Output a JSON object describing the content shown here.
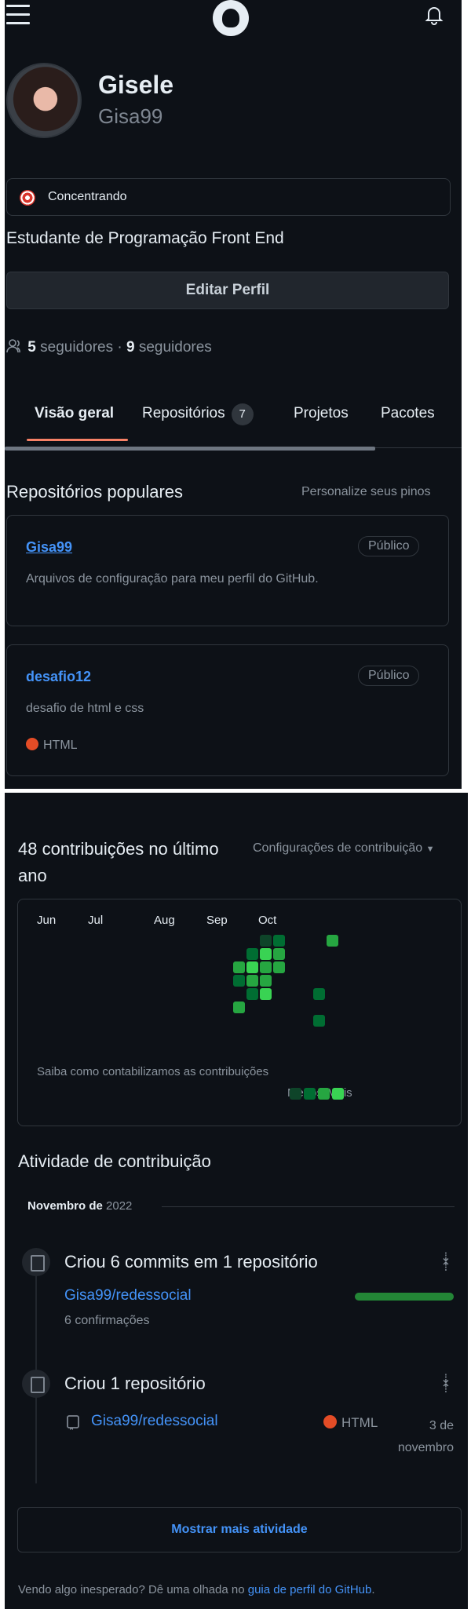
{
  "header": {
    "menu_icon": "hamburger-icon",
    "logo_icon": "github-logo-icon",
    "bell_icon": "bell-icon"
  },
  "profile": {
    "name": "Gisele",
    "login": "Gisa99",
    "status": "Concentrando",
    "status_icon": "dart-target-icon",
    "bio": "Estudante de Programação Front End",
    "edit_button": "Editar Perfil",
    "followers_count": "5",
    "followers_label": "seguidores",
    "following_count": "9",
    "following_label": "seguidores",
    "separator": "·"
  },
  "tabs": [
    {
      "label": "Visão geral",
      "selected": true
    },
    {
      "label": "Repositórios",
      "count": "7"
    },
    {
      "label": "Projetos"
    },
    {
      "label": "Pacotes"
    }
  ],
  "popular": {
    "title": "Repositórios populares",
    "customize": "Personalize seus pinos",
    "repos": [
      {
        "name": "Gisa99",
        "visibility": "Público",
        "description": "Arquivos de configuração para meu perfil do GitHub."
      },
      {
        "name": "desafio12",
        "visibility": "Público",
        "description": "desafio de html e css",
        "language": "HTML",
        "language_color": "#e34c26"
      }
    ]
  },
  "contributions": {
    "title_line1": "48 contribuições no último",
    "title_line2": "ano",
    "settings": "Configurações de contribuição",
    "months": [
      "Jun",
      "Jul",
      "Aug",
      "Sep",
      "Oct"
    ],
    "help": "Saiba como contabilizamos as contribuições",
    "less": "Menos",
    "more": "Mais",
    "colors": [
      "#0e4429",
      "#006d32",
      "#26a641",
      "#39d353"
    ]
  },
  "activity": {
    "title": "Atividade de contribuição",
    "month_bold": "Novembro de",
    "month_year": "2022",
    "items": [
      {
        "title": "Criou 6 commits em 1 repositório",
        "repo": "Gisa99/redessocial",
        "detail": "6 confirmações",
        "progress": 1.0,
        "icon": "repo-push-icon",
        "fold_icon": "unfold-icon"
      },
      {
        "title": "Criou 1 repositório",
        "repo": "Gisa99/redessocial",
        "language": "HTML",
        "date_line1": "3 de",
        "date_line2": "novembro",
        "icon": "repo-icon",
        "fold_icon": "unfold-icon"
      }
    ],
    "show_more": "Mostrar mais atividade"
  },
  "footer": {
    "text": "Vendo algo inesperado? Dê uma olhada no",
    "link": "guia de perfil do GitHub",
    "end": "."
  }
}
